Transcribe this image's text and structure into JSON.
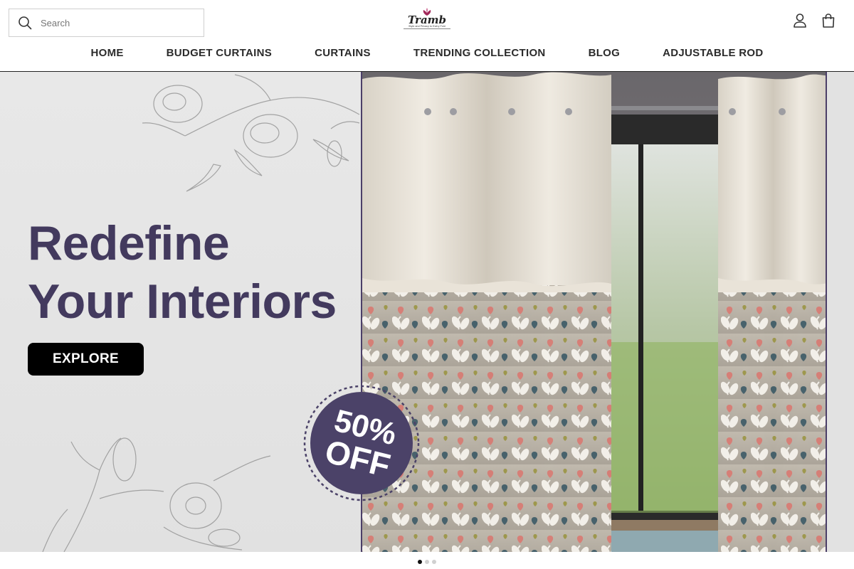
{
  "search": {
    "placeholder": "Search"
  },
  "logo": {
    "name": "Tramb",
    "tagline": "Style and Privacy to Every Fold"
  },
  "nav": [
    {
      "label": "HOME"
    },
    {
      "label": "BUDGET CURTAINS"
    },
    {
      "label": "CURTAINS"
    },
    {
      "label": "TRENDING COLLECTION"
    },
    {
      "label": "BLOG"
    },
    {
      "label": "ADJUSTABLE ROD"
    }
  ],
  "hero": {
    "headline_line1": "Redefine",
    "headline_line2": "Your Interiors",
    "cta_label": "EXPLORE",
    "badge_percent": "50%",
    "badge_off": "OFF"
  },
  "carousel": {
    "slides": 3,
    "active": 1
  },
  "colors": {
    "accent": "#433a5e",
    "cta": "#000000",
    "badge": "#4b4268"
  },
  "icons": [
    "search-icon",
    "account-icon",
    "cart-icon"
  ]
}
